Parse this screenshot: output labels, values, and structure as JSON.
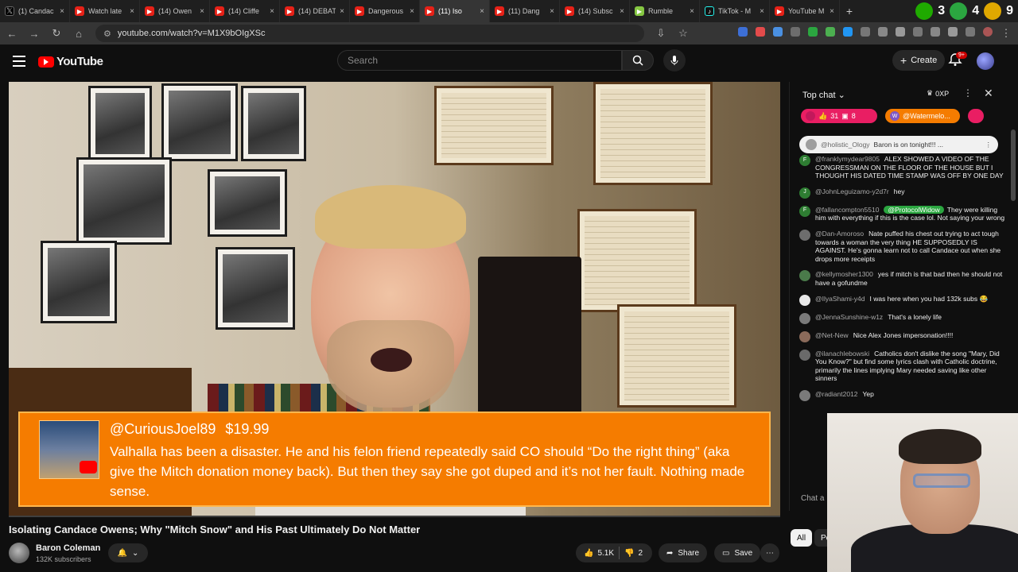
{
  "browser": {
    "tabs": [
      {
        "title": "(1) Candac",
        "icon": "x-logo",
        "active": false
      },
      {
        "title": "Watch late",
        "icon": "youtube-logo",
        "active": false
      },
      {
        "title": "(14) Owen",
        "icon": "youtube-logo",
        "active": false
      },
      {
        "title": "(14) Cliffe",
        "icon": "youtube-logo",
        "active": false
      },
      {
        "title": "(14) DEBAT",
        "icon": "youtube-logo",
        "active": false
      },
      {
        "title": "Dangerous",
        "icon": "youtube-logo",
        "active": false
      },
      {
        "title": "(11) Iso",
        "icon": "youtube-logo",
        "active": true
      },
      {
        "title": "(11) Dang",
        "icon": "youtube-logo",
        "active": false
      },
      {
        "title": "(14) Subsc",
        "icon": "youtube-logo",
        "active": false
      },
      {
        "title": "Rumble",
        "icon": "rumble-logo",
        "active": false
      },
      {
        "title": "TikTok - M",
        "icon": "tiktok-logo",
        "active": false
      },
      {
        "title": "YouTube M",
        "icon": "youtube-logo",
        "active": false
      }
    ],
    "overlay_numbers": [
      "3",
      "4",
      "9"
    ],
    "url": "youtube.com/watch?v=M1X9bOIgXSc"
  },
  "youtube": {
    "logo_text": "YouTube",
    "search_placeholder": "Search",
    "create_label": "Create",
    "notif_count": "9+"
  },
  "superchat": {
    "user": "@CuriousJoel89",
    "amount": "$19.99",
    "message": "Valhalla has been a disaster. He and his felon friend repeatedly said CO should “Do the right thing” (aka give the Mitch donation money back). But then they say she got duped and it’s not her fault. Nothing made sense."
  },
  "video": {
    "title": "Isolating Candace Owens; Why \"Mitch Snow\" and His Past Ultimately Do Not Matter",
    "channel": "Baron Coleman",
    "subscribers": "132K subscribers",
    "likes": "5.1K",
    "dislikes": "2",
    "share_label": "Share",
    "save_label": "Save",
    "progress": 0.0
  },
  "chat": {
    "header": "Top chat",
    "xp_label": "0XP",
    "tickers": [
      {
        "label": "31",
        "sub": "8",
        "color": "#e91e63"
      },
      {
        "label": "@Watermelo...",
        "color": "#f57c00"
      }
    ],
    "pinned": {
      "user": "@holistic_Ology",
      "text": "Baron is on tonight!!! ..."
    },
    "messages": [
      {
        "user": "@franklymydear9805",
        "text": "ALEX SHOWED A VIDEO OF THE CONGRESSMAN ON THE FLOOR OF THE HOUSE BUT I THOUGHT HIS DATED TIME STAMP WAS OFF BY ONE DAY",
        "avatar": "F",
        "color": "#2e7d32"
      },
      {
        "user": "@JohnLeguizamo-y2d7r",
        "text": "hey",
        "avatar": "J",
        "color": "#2e7d32"
      },
      {
        "user": "@fallancompton5510",
        "mention": "@ProtocolWidow",
        "text": "They were killing him with everything if this is the case lol. Not saying your wrong",
        "avatar": "F",
        "color": "#2e7d32"
      },
      {
        "user": "@Dan-Amoroso",
        "text": "Nate puffed his chest out trying to act tough towards a woman the very thing HE SUPPOSEDLY IS AGAINST. He's gonna learn not to call Candace out when she drops more receipts",
        "avatar": "",
        "color": "#6d6d6d"
      },
      {
        "user": "@kellymosher1300",
        "text": "yes if mitch is that bad then he should not have a gofundme",
        "avatar": "",
        "color": "#4a7a4a"
      },
      {
        "user": "@IlyaShami-y4d",
        "text": "I was here when you had 132k subs 😂",
        "avatar": "",
        "color": "#e8e8e8"
      },
      {
        "user": "@JennaSunshine-w1z",
        "text": "That's a lonely life",
        "avatar": "",
        "color": "#7a7a7a"
      },
      {
        "user": "@Net-New",
        "text": "Nice Alex Jones impersonation!!!!",
        "avatar": "",
        "color": "#8a6a5a"
      },
      {
        "user": "@ilanachlebowski",
        "text": "Catholics don't dislike the song \"Mary, Did You Know?\" but find some lyrics clash with Catholic doctrine, primarily the lines implying Mary needed saving like other sinners",
        "avatar": "",
        "color": "#6a6a6a"
      },
      {
        "user": "@radiant2012",
        "text": "Yep",
        "avatar": "",
        "color": "#7a7a7a"
      }
    ],
    "input_placeholder": "Chat a",
    "filter_all": "All",
    "filter_po": "Po"
  }
}
